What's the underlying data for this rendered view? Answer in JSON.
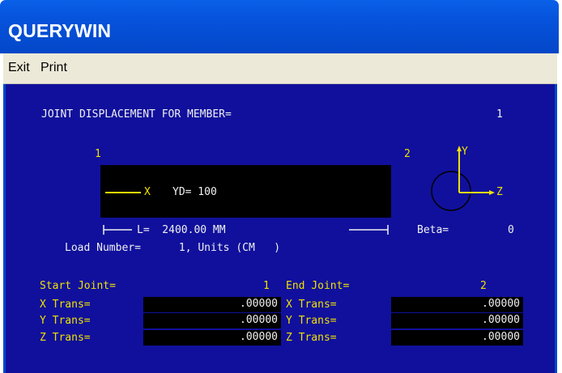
{
  "window": {
    "title": "QUERYWIN"
  },
  "menu": {
    "exit_label": "Exit",
    "print_label": "Print"
  },
  "header": {
    "label": "JOINT DISPLACEMENT FOR MEMBER=",
    "member": "1"
  },
  "diagram": {
    "start_node": "1",
    "end_node": "2",
    "member_axis": "X",
    "yd_label": "YD= 100",
    "length_label": "L=  2400.00 MM",
    "beta_label": "Beta=",
    "beta_value": "0",
    "axis_y": "Y",
    "axis_z": "Z"
  },
  "load": {
    "text": "Load Number=      1, Units (CM   )"
  },
  "start_joint": {
    "label": "Start Joint=",
    "number": "1",
    "rows": [
      {
        "label": "X Trans=",
        "value": ".00000"
      },
      {
        "label": "Y Trans=",
        "value": ".00000"
      },
      {
        "label": "Z Trans=",
        "value": ".00000"
      }
    ]
  },
  "end_joint": {
    "label": "End Joint=",
    "number": "2",
    "rows": [
      {
        "label": "X Trans=",
        "value": ".00000"
      },
      {
        "label": "Y Trans=",
        "value": ".00000"
      },
      {
        "label": "Z Trans=",
        "value": ".00000"
      }
    ]
  },
  "colors": {
    "client_bg": "#10109c",
    "yellow_text": "#f0e000",
    "white_text": "#f0f0f0",
    "title_bar": "#0653dc"
  },
  "icons": {
    "axis_triad": "axis-triad-icon",
    "dimension_arrows": "dimension-line-icon"
  }
}
